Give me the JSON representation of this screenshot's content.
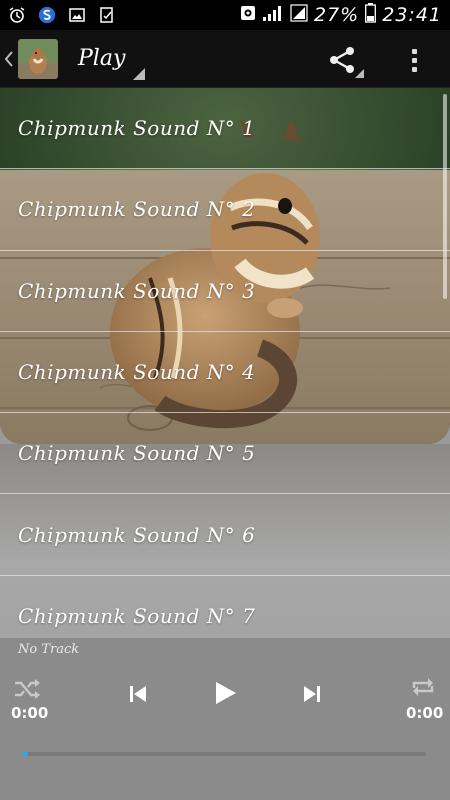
{
  "status_bar": {
    "battery_percent": "27%",
    "time": "23:41",
    "left_icons": [
      "alarm-icon",
      "sync-icon",
      "gallery-icon",
      "clipboard-icon"
    ],
    "right_icons": [
      "signal-icon",
      "battery-icon"
    ]
  },
  "action_bar": {
    "title": "Play",
    "icons": [
      "back-chevron-icon",
      "share-icon",
      "overflow-menu-icon"
    ]
  },
  "tracks": [
    "Chipmunk Sound N° 1",
    "Chipmunk Sound N° 2",
    "Chipmunk Sound N° 3",
    "Chipmunk Sound N° 4",
    "Chipmunk Sound N° 5",
    "Chipmunk Sound N° 6",
    "Chipmunk Sound N° 7"
  ],
  "player": {
    "track_label": "No Track",
    "elapsed": "0:00",
    "duration": "0:00",
    "progress": 0.0,
    "buttons": [
      "shuffle-icon",
      "previous-icon",
      "play-icon",
      "next-icon",
      "repeat-icon"
    ]
  },
  "colors": {
    "accent": "#2fa9e6",
    "player_bg": "#8b8b8b",
    "action_bar_bg": "#111111"
  }
}
